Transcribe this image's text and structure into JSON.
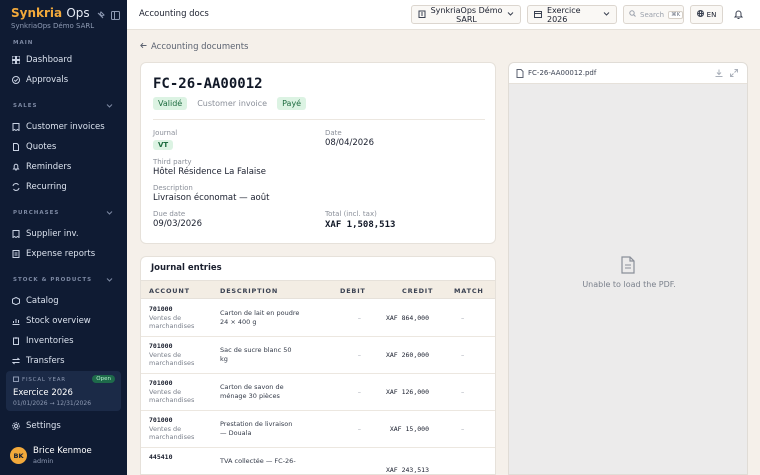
{
  "brand": {
    "name_part1": "Synkria",
    "name_part2": "Ops",
    "company": "SynkriaOps Démo SARL"
  },
  "sidebar": {
    "sections": [
      {
        "label": "MAIN",
        "items": [
          "Dashboard",
          "Approvals"
        ]
      },
      {
        "label": "SALES",
        "items": [
          "Customer invoices",
          "Quotes",
          "Reminders",
          "Recurring"
        ]
      },
      {
        "label": "PURCHASES",
        "items": [
          "Supplier inv.",
          "Expense reports"
        ]
      },
      {
        "label": "STOCK & PRODUCTS",
        "items": [
          "Catalog",
          "Stock overview",
          "Inventories",
          "Transfers"
        ]
      }
    ],
    "fiscal_year": {
      "label": "FISCAL YEAR",
      "status": "Open",
      "name": "Exercice 2026",
      "dates": "01/01/2026 → 12/31/2026"
    },
    "settings": "Settings",
    "user": {
      "initials": "BK",
      "name": "Brice Kenmoe",
      "role": "admin"
    }
  },
  "header": {
    "title": "Accounting docs",
    "company_line1": "SynkriaOps Démo",
    "company_line2": "SARL",
    "exercise": "Exercice 2026",
    "search_placeholder": "Search",
    "search_kbd": "⌘K",
    "lang": "EN"
  },
  "breadcrumb": "Accounting documents",
  "document": {
    "number": "FC-26-AA00012",
    "status": "Validé",
    "type": "Customer invoice",
    "payment": "Payé",
    "journal_label": "Journal",
    "journal_value": "VT",
    "date_label": "Date",
    "date_value": "08/04/2026",
    "third_party_label": "Third party",
    "third_party_value": "Hôtel Résidence La Falaise",
    "description_label": "Description",
    "description_value": "Livraison économat — août",
    "due_label": "Due date",
    "due_value": "09/03/2026",
    "total_label": "Total (incl. tax)",
    "total_value": "XAF 1,508,513"
  },
  "journal": {
    "title": "Journal entries",
    "columns": {
      "account": "ACCOUNT",
      "description": "DESCRIPTION",
      "debit": "DEBIT",
      "credit": "CREDIT",
      "match": "MATCH"
    },
    "rows": [
      {
        "account": "701000",
        "account_name": "Ventes de marchandises",
        "description": "Carton de lait en poudre 24 × 400 g",
        "debit": "–",
        "credit": "XAF 864,000",
        "match": "–"
      },
      {
        "account": "701000",
        "account_name": "Ventes de marchandises",
        "description": "Sac de sucre blanc 50 kg",
        "debit": "–",
        "credit": "XAF 260,000",
        "match": "–"
      },
      {
        "account": "701000",
        "account_name": "Ventes de marchandises",
        "description": "Carton de savon de ménage 30 pièces",
        "debit": "–",
        "credit": "XAF 126,000",
        "match": "–"
      },
      {
        "account": "701000",
        "account_name": "Ventes de marchandises",
        "description": "Prestation de livraison — Douala",
        "debit": "–",
        "credit": "XAF 15,000",
        "match": "–"
      },
      {
        "account": "445410",
        "account_name": "",
        "description": "TVA collectée — FC-26-",
        "debit": "",
        "credit": "XAF 243,513",
        "match": ""
      }
    ]
  },
  "pdf": {
    "filename": "FC-26-AA00012.pdf",
    "error": "Unable to load the PDF."
  }
}
